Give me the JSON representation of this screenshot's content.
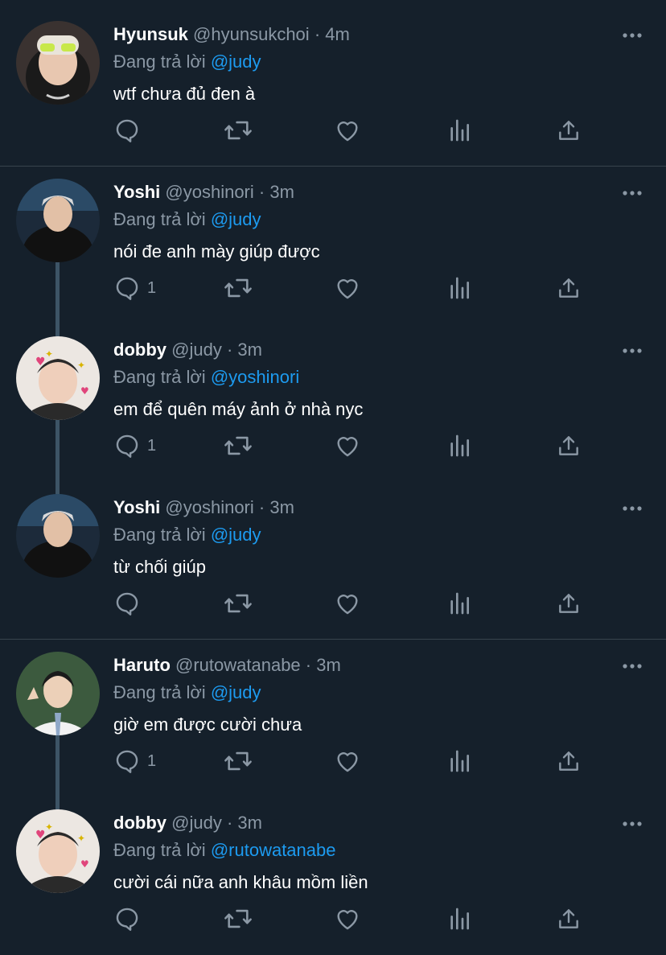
{
  "tweets": [
    {
      "name": "Hyunsuk",
      "handle": "@hyunsukchoi",
      "dot": "·",
      "time": "4m",
      "reply_prefix": "Đang trả lời",
      "reply_to": "@judy",
      "text": "wtf chưa đủ đen à",
      "reply_count": ""
    },
    {
      "name": "Yoshi",
      "handle": "@yoshinori",
      "dot": "·",
      "time": "3m",
      "reply_prefix": "Đang trả lời",
      "reply_to": "@judy",
      "text": "nói đe anh mày giúp được",
      "reply_count": "1"
    },
    {
      "name": "dobby",
      "handle": "@judy",
      "dot": "·",
      "time": "3m",
      "reply_prefix": "Đang trả lời",
      "reply_to": "@yoshinori",
      "text": "em để quên máy ảnh ở nhà nyc",
      "reply_count": "1"
    },
    {
      "name": "Yoshi",
      "handle": "@yoshinori",
      "dot": "·",
      "time": "3m",
      "reply_prefix": "Đang trả lời",
      "reply_to": "@judy",
      "text": "từ chối giúp",
      "reply_count": ""
    },
    {
      "name": "Haruto",
      "handle": "@rutowatanabe",
      "dot": "·",
      "time": "3m",
      "reply_prefix": "Đang trả lời",
      "reply_to": "@judy",
      "text": "giờ em được cười chưa",
      "reply_count": "1"
    },
    {
      "name": "dobby",
      "handle": "@judy",
      "dot": "·",
      "time": "3m",
      "reply_prefix": "Đang trả lời",
      "reply_to": "@rutowatanabe",
      "text": "cười cái nữa anh khâu mồm liền",
      "reply_count": ""
    }
  ],
  "icons": {
    "reply": "reply-icon",
    "retweet": "retweet-icon",
    "like": "heart-icon",
    "views": "views-icon",
    "share": "share-icon",
    "more": "more-icon"
  },
  "colors": {
    "background": "#15202b",
    "text": "#ffffff",
    "secondary": "#8b98a5",
    "accent": "#1d9bf0",
    "divider": "#38444d",
    "thread": "#3d5466"
  }
}
